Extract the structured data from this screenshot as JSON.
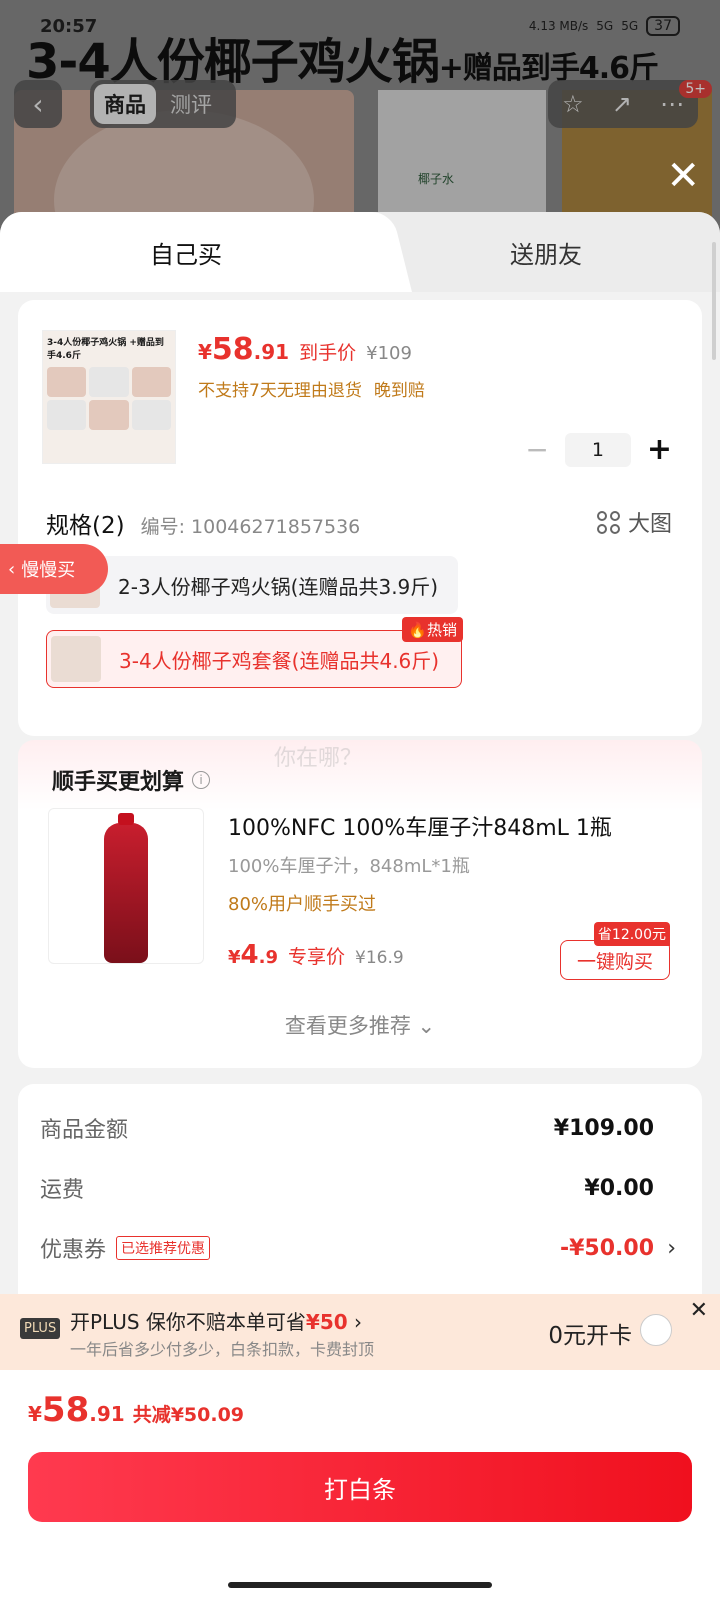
{
  "status_bar": {
    "time": "20:57",
    "net_speed": "4.13 MB/s",
    "signal1": "5G",
    "signal2": "5G",
    "battery": "37"
  },
  "background": {
    "title_main": "3-4人份椰子鸡火锅",
    "title_extra": "+赠品到手4.6斤",
    "tab_goods": "商品",
    "tab_reviews": "测评",
    "cart_badge": "5+",
    "coconut_label": "椰子水"
  },
  "tabs": {
    "self": "自己买",
    "friend": "送朋友"
  },
  "product": {
    "thumb_title": "3-4人份椰子鸡火锅 +赠品到手4.6斤",
    "currency": "¥",
    "price_int": "58",
    "price_dec": ".91",
    "price_tag": "到手价",
    "orig_price": "¥109",
    "return_note": "不支持7天无理由退货",
    "late_pay": "晚到赔",
    "quantity": "1",
    "spec_title": "规格(2)",
    "spec_code": "编号: 10046271857536",
    "big_image": "大图",
    "options": [
      {
        "label": "2-3人份椰子鸡火锅(连赠品共3.9斤)"
      },
      {
        "label": "3-4人份椰子鸡套餐(连赠品共4.6斤)",
        "badge": "热销"
      }
    ]
  },
  "slow_buy": "慢慢买",
  "addon": {
    "ghost_text": "你在哪？",
    "title": "顺手买更划算",
    "item_title": "100%NFC 100%车厘子汁848mL 1瓶",
    "item_sub": "100%车厘子汁，848mL*1瓶",
    "item_users": "80%用户顺手买过",
    "currency": "¥",
    "price_int": "4",
    "price_dec": ".9",
    "price_tag": "专享价",
    "orig_price": "¥16.9",
    "save_tag": "省12.00元",
    "buy_button": "一键购买",
    "more": "查看更多推荐"
  },
  "summary": {
    "goods_label": "商品金额",
    "goods_value": "¥109.00",
    "ship_label": "运费",
    "ship_value": "¥0.00",
    "coupon_label": "优惠券",
    "coupon_tag": "已选推荐优惠",
    "coupon_value": "-¥50.00"
  },
  "plus": {
    "badge": "PLUS",
    "title_prefix": "开PLUS 保你不赔本单可省",
    "title_amount": "¥50",
    "sub": "一年后省多少付多少，白条扣款，卡费封顶",
    "open": "0元开卡"
  },
  "footer": {
    "currency": "¥",
    "total_int": "58",
    "total_dec": ".91",
    "reduce": "共减¥50.09",
    "pay_button": "打白条"
  },
  "colors": {
    "accent": "#e8322d",
    "warning": "#c07a1a"
  }
}
